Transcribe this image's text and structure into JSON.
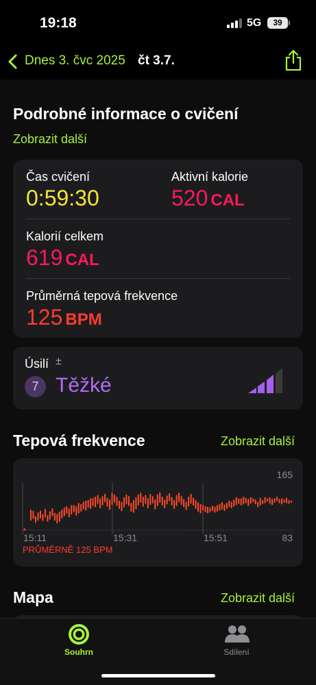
{
  "status_bar": {
    "time": "19:18",
    "network": "5G",
    "battery": "39"
  },
  "nav": {
    "back_label": "Dnes 3. čvc 2025",
    "day_label": "čt 3.7."
  },
  "details": {
    "title": "Podrobné informace o cvičení",
    "more": "Zobrazit další",
    "metrics": {
      "workout_time": {
        "label": "Čas cvičení",
        "value": "0:59:30",
        "color": "#f6e43b"
      },
      "active_cal": {
        "label": "Aktivní kalorie",
        "value": "520",
        "unit": "CAL",
        "color": "#fb1a5b"
      },
      "total_cal": {
        "label": "Kalorií celkem",
        "value": "619",
        "unit": "CAL",
        "color": "#fb1a5b"
      },
      "avg_hr": {
        "label": "Průměrná tepová frekvence",
        "value": "125",
        "unit": "BPM",
        "color": "#ff3b30"
      }
    }
  },
  "effort": {
    "label": "Úsilí",
    "info_symbol": "±",
    "level": "7",
    "level_text": "Těžké",
    "color": "#b26cf7",
    "bars_filled": 3,
    "bars_total": 4
  },
  "heart_rate": {
    "title": "Tepová frekvence",
    "more": "Zobrazit další",
    "avg_label": "PRŮMĚRNĚ 125 BPM",
    "color": "#ff4b2b"
  },
  "map": {
    "title": "Mapa",
    "more": "Zobrazit další"
  },
  "tabbar": {
    "summary": {
      "label": "Souhrn",
      "icon": "activity-rings-icon",
      "color": "#a7f33a"
    },
    "sharing": {
      "label": "Sdílení",
      "icon": "people-icon",
      "color": "#8e8e93"
    }
  },
  "chart_data": {
    "type": "bar",
    "title": "",
    "x_ticks": [
      "15:11",
      "15:31",
      "15:51"
    ],
    "y_ticks": [
      83,
      165
    ],
    "ylim": [
      83,
      165
    ],
    "grid": true,
    "series": [
      {
        "values": [
          [
            100,
            120
          ],
          [
            103,
            118
          ],
          [
            96,
            108
          ],
          [
            100,
            115
          ],
          [
            104,
            118
          ],
          [
            99,
            112
          ],
          [
            106,
            121
          ],
          [
            98,
            110
          ],
          [
            102,
            117
          ],
          [
            108,
            122
          ],
          [
            100,
            114
          ],
          [
            95,
            112
          ],
          [
            98,
            116
          ],
          [
            104,
            120
          ],
          [
            108,
            124
          ],
          [
            112,
            126
          ],
          [
            106,
            122
          ],
          [
            111,
            128
          ],
          [
            115,
            128
          ],
          [
            109,
            126
          ],
          [
            113,
            132
          ],
          [
            116,
            130
          ],
          [
            120,
            134
          ],
          [
            118,
            136
          ],
          [
            123,
            137
          ],
          [
            121,
            140
          ],
          [
            126,
            141
          ],
          [
            124,
            143
          ],
          [
            130,
            146
          ],
          [
            122,
            140
          ],
          [
            127,
            144
          ],
          [
            133,
            148
          ],
          [
            125,
            141
          ],
          [
            119,
            138
          ],
          [
            128,
            150
          ],
          [
            132,
            147
          ],
          [
            126,
            143
          ],
          [
            121,
            136
          ],
          [
            117,
            134
          ],
          [
            124,
            142
          ],
          [
            129,
            147
          ],
          [
            126,
            144
          ],
          [
            116,
            132
          ],
          [
            114,
            137
          ],
          [
            120,
            142
          ],
          [
            127,
            147
          ],
          [
            132,
            150
          ],
          [
            125,
            143
          ],
          [
            130,
            146
          ],
          [
            122,
            140
          ],
          [
            128,
            148
          ],
          [
            131,
            144
          ],
          [
            120,
            138
          ],
          [
            126,
            147
          ],
          [
            132,
            151
          ],
          [
            127,
            143
          ],
          [
            122,
            138
          ],
          [
            129,
            145
          ],
          [
            135,
            149
          ],
          [
            127,
            142
          ],
          [
            121,
            137
          ],
          [
            126,
            146
          ],
          [
            133,
            150
          ],
          [
            128,
            144
          ],
          [
            124,
            139
          ],
          [
            119,
            134
          ],
          [
            125,
            143
          ],
          [
            130,
            148
          ],
          [
            127,
            141
          ],
          [
            121,
            137
          ],
          [
            116,
            133
          ],
          [
            113,
            130
          ],
          [
            118,
            128
          ],
          [
            115,
            126
          ],
          [
            113,
            125
          ],
          [
            115,
            124
          ],
          [
            117,
            127
          ],
          [
            114,
            125
          ],
          [
            116,
            128
          ],
          [
            118,
            130
          ],
          [
            120,
            133
          ],
          [
            117,
            129
          ],
          [
            121,
            132
          ],
          [
            124,
            136
          ],
          [
            122,
            134
          ],
          [
            125,
            138
          ],
          [
            128,
            142
          ],
          [
            130,
            140
          ],
          [
            127,
            140
          ],
          [
            129,
            143
          ],
          [
            131,
            141
          ],
          [
            126,
            139
          ],
          [
            130,
            142
          ],
          [
            133,
            140
          ],
          [
            129,
            138
          ],
          [
            124,
            134
          ],
          [
            127,
            141
          ],
          [
            130,
            137
          ],
          [
            131,
            142
          ],
          [
            134,
            140
          ],
          [
            130,
            142
          ],
          [
            128,
            139
          ],
          [
            132,
            140
          ],
          [
            135,
            143
          ],
          [
            131,
            139
          ],
          [
            129,
            140
          ],
          [
            132,
            138
          ],
          [
            131,
            141
          ],
          [
            130,
            137
          ],
          [
            132,
            136
          ]
        ]
      }
    ]
  }
}
